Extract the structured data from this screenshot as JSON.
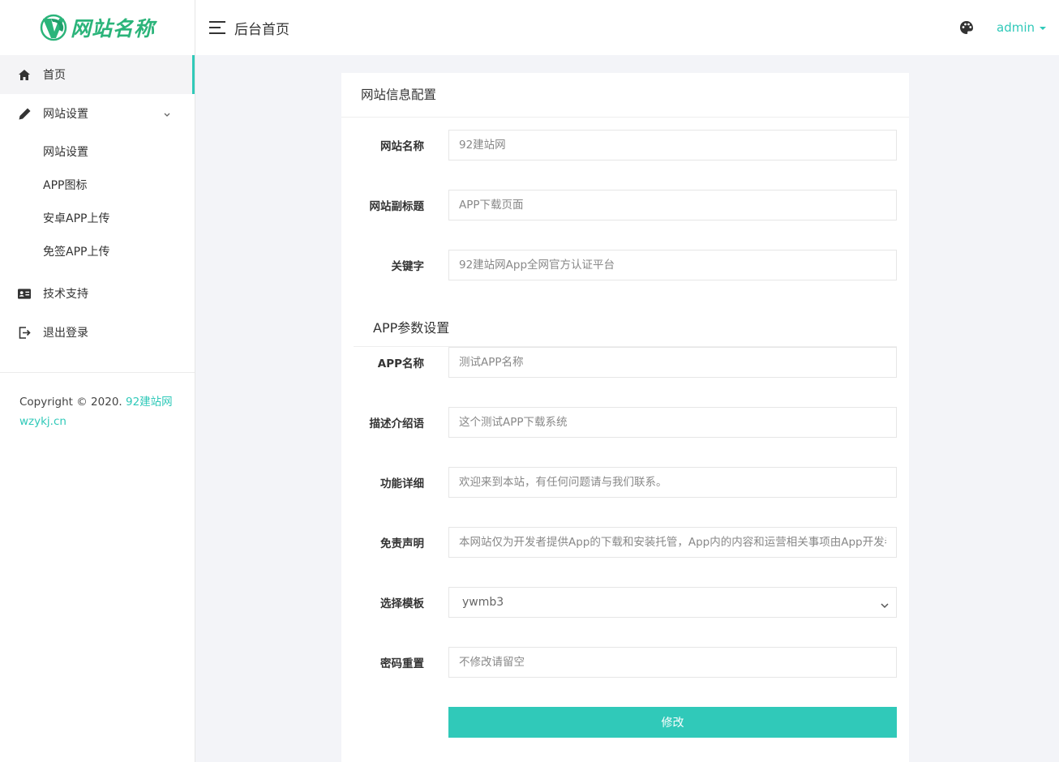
{
  "logo": {
    "text": "网站名称",
    "brand_color": "#2bb47a"
  },
  "sidebar": {
    "items": [
      {
        "label": "首页",
        "icon": "home-icon",
        "active": true
      },
      {
        "label": "网站设置",
        "icon": "pencil-icon",
        "expanded": true,
        "children": [
          {
            "label": "网站设置"
          },
          {
            "label": "APP图标"
          },
          {
            "label": "安卓APP上传"
          },
          {
            "label": "免签APP上传"
          }
        ]
      },
      {
        "label": "技术支持",
        "icon": "id-card-icon"
      },
      {
        "label": "退出登录",
        "icon": "logout-icon"
      }
    ],
    "copyright_prefix": "Copyright © 2020.",
    "copyright_link1": "92建站网",
    "copyright_link2": "wzykj.cn"
  },
  "header": {
    "title": "后台首页",
    "user": "admin",
    "accent_color": "#30c9b9"
  },
  "card": {
    "title": "网站信息配置",
    "site_fields": [
      {
        "label": "网站名称",
        "placeholder": "92建站网"
      },
      {
        "label": "网站副标题",
        "placeholder": "APP下载页面"
      },
      {
        "label": "关键字",
        "placeholder": "92建站网App全网官方认证平台"
      }
    ],
    "app_section_title": "APP参数设置",
    "app_fields": [
      {
        "label": "APP名称",
        "placeholder": "测试APP名称"
      },
      {
        "label": "描述介绍语",
        "placeholder": "这个测试APP下载系统"
      },
      {
        "label": "功能详细",
        "placeholder": "欢迎来到本站，有任何问题请与我们联系。"
      },
      {
        "label": "免责声明",
        "placeholder": "本网站仅为开发者提供App的下载和安装托管，App内的内容和运营相关事项由App开发者负责，与本网站无关。"
      }
    ],
    "template_label": "选择模板",
    "template_value": "ywmb3",
    "password_label": "密码重置",
    "password_placeholder": "不修改请留空",
    "submit_label": "修改"
  }
}
